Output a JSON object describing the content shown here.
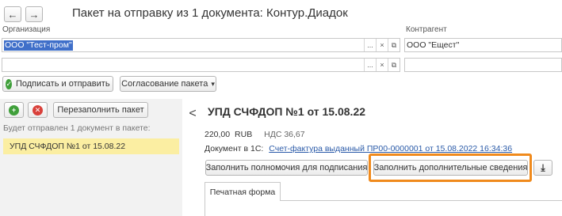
{
  "window": {
    "title": "Пакет на отправку из 1 документа: Контур.Диадок",
    "back_icon": "←",
    "forward_icon": "→"
  },
  "form": {
    "organization_label": "Организация",
    "organization_value": "ООО \"Тест-пром\"",
    "counterparty_label": "Контрагент",
    "counterparty_value": "ООО \"Ещест\"",
    "field_buttons": {
      "select": "...",
      "clear": "×",
      "open": "⧉"
    }
  },
  "toolbar": {
    "sign_send_label": "Подписать и отправить",
    "approval_label": "Согласование пакета",
    "approval_arrow": "▾"
  },
  "left_panel": {
    "add_icon": "+",
    "remove_icon": "✕",
    "refill_label": "Перезаполнить пакет",
    "info_text": "Будет отправлен 1 документ в пакете:",
    "items": [
      {
        "label": "УПД СЧФДОП №1 от 15.08.22"
      }
    ],
    "collapse_icon": "<"
  },
  "document": {
    "title": "УПД СЧФДОП №1 от 15.08.22",
    "amount": "220,00",
    "currency": "RUB",
    "vat": "НДС 36,67",
    "doc_in_1c_label": "Документ в 1С:",
    "doc_in_1c_link": "Счет-фактура выданный ПР00-0000001 от 15.08.2022 16:34:36",
    "fill_authority_label": "Заполнить полномочия для подписания",
    "fill_extra_label": "Заполнить дополнительные сведения",
    "download_icon": "⤓",
    "tabs": [
      {
        "label": "Печатная форма"
      }
    ]
  },
  "colors": {
    "highlight": "#f08a1c",
    "selection": "#3f6fc9",
    "list_selected": "#fbeea2",
    "link": "#2a5aa8"
  }
}
